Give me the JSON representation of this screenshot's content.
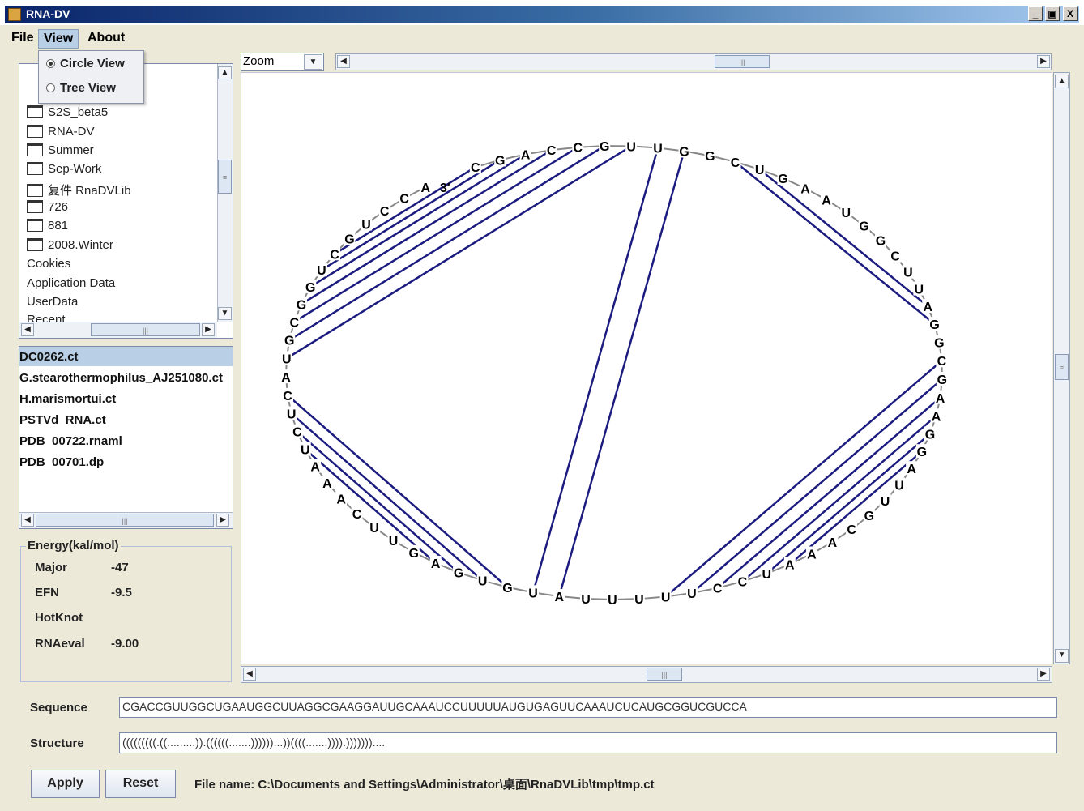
{
  "window": {
    "title": "RNA-DV",
    "min": "_",
    "max": "ð",
    "close": "X"
  },
  "menu": {
    "file": "File",
    "view": "View",
    "about": "About"
  },
  "view_menu": {
    "items": [
      {
        "label": "Circle View",
        "selected": true
      },
      {
        "label": "Tree View",
        "selected": false
      }
    ]
  },
  "tree": {
    "items": [
      "S2S_beta5",
      "RNA-DV",
      "Summer",
      "Sep-Work",
      "复件 RnaDVLib",
      "726",
      "881",
      "2008.Winter",
      "Cookies",
      "Application Data",
      "UserData",
      "Recent"
    ]
  },
  "files": {
    "selected": "DC0262.ct",
    "items": [
      "DC0262.ct",
      "G.stearothermophilus_AJ251080.ct",
      "H.marismortui.ct",
      "PSTVd_RNA.ct",
      "PDB_00722.rnaml",
      "PDB_00701.dp"
    ]
  },
  "energy": {
    "title": "Energy(kal/mol)",
    "rows": [
      {
        "label": "Major",
        "value": "-47"
      },
      {
        "label": "EFN",
        "value": "-9.5"
      },
      {
        "label": "HotKnot",
        "value": ""
      },
      {
        "label": "RNAeval",
        "value": "-9.00"
      }
    ]
  },
  "zoom": {
    "label": "Zoom"
  },
  "rna": {
    "sequence_label": "Sequence",
    "structure_label": "Structure",
    "sequence": "CGACCGUUGGCUGAAUGGCUUAGGCGAAGGAUUGCAAAUCCUUUUUAUGUGAGUUCAAAUCUCAUGCGGUCGUCCA",
    "structure": "(((((((((.((.........)).((((((.......))))))...))((((.......)))).)))))))....",
    "end_label": "3'"
  },
  "buttons": {
    "apply": "Apply",
    "reset": "Reset"
  },
  "status": {
    "filename": "File name: C:\\Documents and Settings\\Administrator\\桌面\\RnaDVLib\\tmp\\tmp.ct"
  },
  "colors": {
    "bond": "#1c1c80",
    "backbone": "#888888",
    "selection": "#b8cfe5"
  }
}
